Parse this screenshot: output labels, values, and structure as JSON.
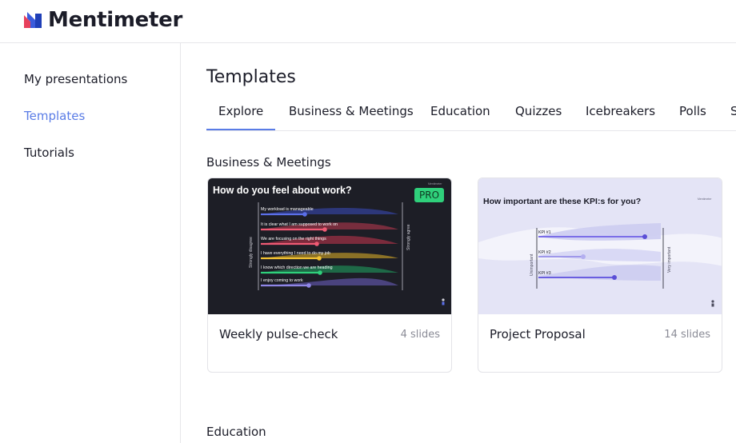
{
  "app": {
    "brand": "Mentimeter",
    "accent": "#5a7ce6"
  },
  "sidebar": {
    "items": [
      {
        "label": "My presentations",
        "active": false
      },
      {
        "label": "Templates",
        "active": true
      },
      {
        "label": "Tutorials",
        "active": false
      }
    ]
  },
  "main": {
    "title": "Templates",
    "tabs": [
      {
        "label": "Explore",
        "active": true
      },
      {
        "label": "Business & Meetings",
        "active": false
      },
      {
        "label": "Education",
        "active": false
      },
      {
        "label": "Quizzes",
        "active": false
      },
      {
        "label": "Icebreakers",
        "active": false
      },
      {
        "label": "Polls",
        "active": false
      },
      {
        "label": "S",
        "active": false
      }
    ],
    "sections": [
      {
        "title": "Business & Meetings",
        "cards": [
          {
            "name": "Weekly pulse-check",
            "slides": "4 slides",
            "badge": "PRO",
            "thumb": {
              "title": "How do you feel about work?",
              "brand_small": "Mentimeter",
              "left_axis": "Strongly disagree",
              "right_axis": "Strongly agree",
              "rows": [
                "My workload is manageable",
                "It is clear what I am supposed to work on",
                "We are focusing on the right things",
                "I have everything I need to do my job",
                "I know which direction we are heading",
                "I enjoy coming to work"
              ]
            }
          },
          {
            "name": "Project Proposal",
            "slides": "14 slides",
            "thumb": {
              "title": "How important are these KPI:s for you?",
              "brand_small": "Mentimeter",
              "left_axis": "Unimportant",
              "right_axis": "Very important",
              "rows": [
                "KPI #1",
                "KPI #2",
                "KPI #3"
              ]
            }
          }
        ]
      },
      {
        "title": "Education",
        "cards": []
      }
    ]
  }
}
